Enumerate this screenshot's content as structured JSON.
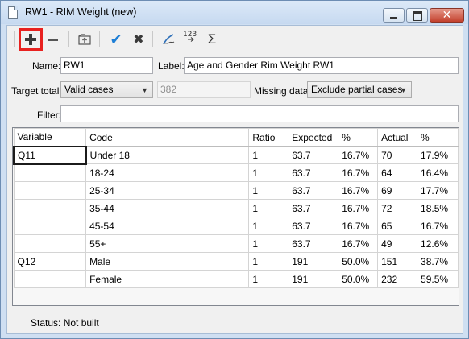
{
  "window": {
    "title": "RW1 - RIM Weight (new)",
    "close_glyph": "✕"
  },
  "toolbar": {
    "items": [
      {
        "name": "add-icon",
        "highlighted": true
      },
      {
        "name": "remove-icon"
      },
      {
        "name": "move-up-icon"
      },
      {
        "name": "apply-check-icon",
        "glyph": "✔",
        "color": "#1e7fd6"
      },
      {
        "name": "cancel-x-icon",
        "glyph": "✖",
        "color": "#3a3a3a"
      },
      {
        "name": "pen-icon",
        "glyph": "✍"
      },
      {
        "name": "numbering-icon",
        "glyph": "¹²³"
      },
      {
        "name": "sum-icon",
        "glyph": "Σ"
      }
    ]
  },
  "form": {
    "name_label": "Name:",
    "name_value": "RW1",
    "label_label": "Label:",
    "label_value": "Age and Gender Rim Weight RW1",
    "target_label": "Target total:",
    "target_value": "Valid cases",
    "target_count": "382",
    "missing_label": "Missing data:",
    "missing_value": "Exclude partial cases",
    "filter_label": "Filter:",
    "filter_value": ""
  },
  "grid": {
    "columns": [
      "Variable",
      "Code",
      "Ratio",
      "Expected",
      "%",
      "Actual",
      "%"
    ],
    "rows": [
      {
        "variable": "Q11",
        "code": "Under 18",
        "ratio": "1",
        "expected": "63.7",
        "exp_pct": "16.7%",
        "actual": "70",
        "act_pct": "17.9%"
      },
      {
        "variable": "",
        "code": "18-24",
        "ratio": "1",
        "expected": "63.7",
        "exp_pct": "16.7%",
        "actual": "64",
        "act_pct": "16.4%"
      },
      {
        "variable": "",
        "code": "25-34",
        "ratio": "1",
        "expected": "63.7",
        "exp_pct": "16.7%",
        "actual": "69",
        "act_pct": "17.7%"
      },
      {
        "variable": "",
        "code": "35-44",
        "ratio": "1",
        "expected": "63.7",
        "exp_pct": "16.7%",
        "actual": "72",
        "act_pct": "18.5%"
      },
      {
        "variable": "",
        "code": "45-54",
        "ratio": "1",
        "expected": "63.7",
        "exp_pct": "16.7%",
        "actual": "65",
        "act_pct": "16.7%"
      },
      {
        "variable": "",
        "code": "55+",
        "ratio": "1",
        "expected": "63.7",
        "exp_pct": "16.7%",
        "actual": "49",
        "act_pct": "12.6%"
      },
      {
        "variable": "Q12",
        "code": "Male",
        "ratio": "1",
        "expected": "191",
        "exp_pct": "50.0%",
        "actual": "151",
        "act_pct": "38.7%"
      },
      {
        "variable": "",
        "code": "Female",
        "ratio": "1",
        "expected": "191",
        "exp_pct": "50.0%",
        "actual": "232",
        "act_pct": "59.5%"
      }
    ]
  },
  "status": {
    "text": "Status: Not built"
  }
}
